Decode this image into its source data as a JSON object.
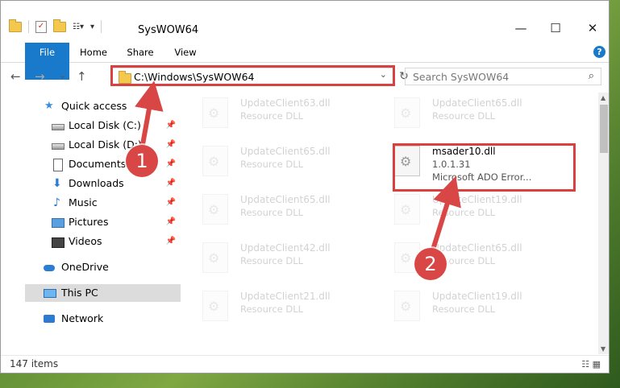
{
  "window": {
    "title": "SysWOW64",
    "minimize": "—",
    "maximize": "☐",
    "close": "✕"
  },
  "qat": {
    "dropdown": "▾"
  },
  "ribbon": {
    "tabs": [
      "File",
      "Home",
      "Share",
      "View"
    ],
    "help": "?"
  },
  "nav": {
    "back": "←",
    "forward": "→",
    "recent": "⌄",
    "up": "↑",
    "address": "C:\\Windows\\SysWOW64",
    "address_dropdown": "⌄",
    "refresh": "↻",
    "search_placeholder": "Search SysWOW64",
    "search_icon": "⌕"
  },
  "sidebar": {
    "items": [
      {
        "label": "Quick access",
        "icon": "star-icon",
        "pinned": false
      },
      {
        "label": "Local Disk (C:)",
        "icon": "disk-icon",
        "pinned": true
      },
      {
        "label": "Local Disk (D:)",
        "icon": "disk-icon",
        "pinned": true
      },
      {
        "label": "Documents",
        "icon": "document-icon",
        "pinned": true
      },
      {
        "label": "Downloads",
        "icon": "download-icon",
        "pinned": true
      },
      {
        "label": "Music",
        "icon": "music-icon",
        "pinned": true
      },
      {
        "label": "Pictures",
        "icon": "pictures-icon",
        "pinned": true
      },
      {
        "label": "Videos",
        "icon": "videos-icon",
        "pinned": true
      },
      {
        "label": "OneDrive",
        "icon": "onedrive-icon",
        "pinned": false
      },
      {
        "label": "This PC",
        "icon": "pc-icon",
        "pinned": false,
        "selected": true
      },
      {
        "label": "Network",
        "icon": "network-icon",
        "pinned": false
      }
    ],
    "pin_glyph": "📌"
  },
  "files": [
    {
      "name": "UpdateClient63.dll",
      "type": "Resource DLL",
      "faded": true
    },
    {
      "name": "UpdateClient65.dll",
      "type": "Resource DLL",
      "faded": true
    },
    {
      "name": "UpdateClient65.dll",
      "type": "Resource DLL",
      "faded": true
    },
    {
      "name": "msader10.dll",
      "version": "1.0.1.31",
      "description": "Microsoft ADO Error...",
      "faded": false
    },
    {
      "name": "UpdateClient65.dll",
      "type": "Resource DLL",
      "faded": true
    },
    {
      "name": "UpdateClient19.dll",
      "type": "Resource DLL",
      "faded": true
    },
    {
      "name": "UpdateClient42.dll",
      "type": "Resource DLL",
      "faded": true
    },
    {
      "name": "UpdateClient65.dll",
      "type": "Resource DLL",
      "faded": true
    },
    {
      "name": "UpdateClient21.dll",
      "type": "Resource DLL",
      "faded": true
    },
    {
      "name": "UpdateClient19.dll",
      "type": "Resource DLL",
      "faded": true
    }
  ],
  "status": {
    "item_count": "147 items",
    "views": "☷ ▦"
  },
  "callouts": [
    "1",
    "2"
  ],
  "colors": {
    "accent": "#1979ca",
    "highlight": "#d94040",
    "callout": "#d94646"
  }
}
